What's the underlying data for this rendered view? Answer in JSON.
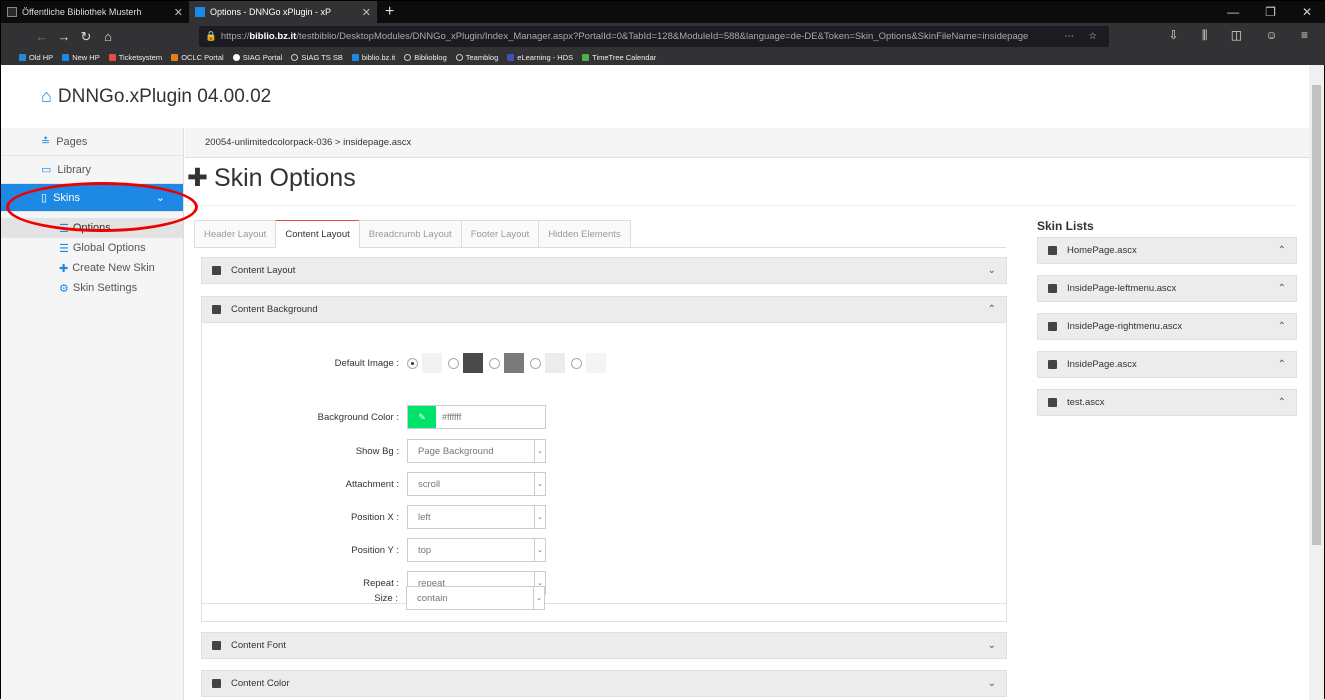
{
  "browser": {
    "tabs": [
      {
        "title": "Öffentliche Bibliothek Musterh",
        "favicon_color": "#222222"
      },
      {
        "title": "Options - DNNGo xPlugin - xP",
        "favicon_color": "#1e88e5"
      }
    ],
    "new_tab": "+",
    "url_host": "biblio.bz.it",
    "url_prefix": "https://",
    "url_rest": "/testbiblio/DesktopModules/DNNGo_xPlugin/Index_Manager.aspx?PortalId=0&TabId=128&ModuleId=588&language=de-DE&Token=Skin_Options&SkinFileName=insidepage",
    "bookmarks": [
      {
        "label": "Old HP",
        "color": "#1e88e5"
      },
      {
        "label": "New HP",
        "color": "#1e88e5"
      },
      {
        "label": "Ticketsystem",
        "color": "#e74c3c"
      },
      {
        "label": "OCLC Portal",
        "color": "#e67e22"
      },
      {
        "label": "SIAG Portal",
        "color": "#ffffff"
      },
      {
        "label": "SIAG TS SB",
        "color": "#cccccc"
      },
      {
        "label": "biblio.bz.it",
        "color": "#1e88e5"
      },
      {
        "label": "Biblioblog",
        "color": "#cccccc"
      },
      {
        "label": "Teamblog",
        "color": "#cccccc"
      },
      {
        "label": "eLearning - HDS",
        "color": "#3f51b5"
      },
      {
        "label": "TimeTree Calendar",
        "color": "#4caf50"
      }
    ]
  },
  "app": {
    "title": "DNNGo.xPlugin 04.00.02"
  },
  "sidebar": {
    "items": [
      {
        "label": "Pages",
        "icon": "pages-icon"
      },
      {
        "label": "Library",
        "icon": "library-icon"
      },
      {
        "label": "Skins",
        "icon": "skins-icon"
      }
    ],
    "sub_items": [
      {
        "label": "Options",
        "icon": "database-icon"
      },
      {
        "label": "Global Options",
        "icon": "database-icon"
      },
      {
        "label": "Create New Skin",
        "icon": "plus-icon"
      },
      {
        "label": "Skin Settings",
        "icon": "gear-icon"
      }
    ]
  },
  "breadcrumb": "20054-unlimitedcolorpack-036 > insidepage.ascx",
  "page_title": "Skin Options",
  "tabs": [
    "Header Layout",
    "Content Layout",
    "Breadcrumb Layout",
    "Footer Layout",
    "Hidden Elements"
  ],
  "sections": {
    "content_layout": "Content Layout",
    "content_background": "Content Background",
    "content_font": "Content Font",
    "content_color": "Content Color"
  },
  "form": {
    "default_image_label": "Default Image :",
    "background_color_label": "Background Color :",
    "background_color_value": "#ffffff",
    "swatch_color": "#00e36b",
    "show_bg_label": "Show Bg :",
    "show_bg_value": "Page Background",
    "attachment_label": "Attachment :",
    "attachment_value": "scroll",
    "position_x_label": "Position X :",
    "position_x_value": "left",
    "position_y_label": "Position Y :",
    "position_y_value": "top",
    "repeat_label": "Repeat :",
    "repeat_value": "repeat",
    "size_label": "Size :",
    "size_value": "contain"
  },
  "skin_lists": {
    "title": "Skin Lists",
    "items": [
      "HomePage.ascx",
      "InsidePage-leftmenu.ascx",
      "InsidePage-rightmenu.ascx",
      "InsidePage.ascx",
      "test.ascx"
    ]
  }
}
